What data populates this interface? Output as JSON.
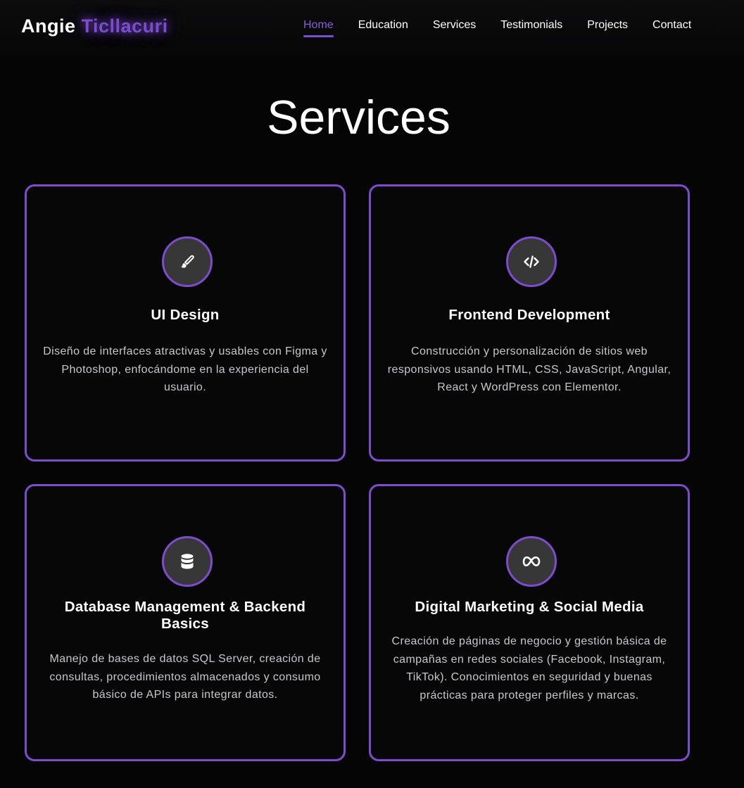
{
  "header": {
    "logo_first": "Angie",
    "logo_last": "Ticllacuri",
    "nav": [
      {
        "label": "Home",
        "active": true
      },
      {
        "label": "Education"
      },
      {
        "label": "Services"
      },
      {
        "label": "Testimonials"
      },
      {
        "label": "Projects"
      },
      {
        "label": "Contact"
      }
    ]
  },
  "main": {
    "title": "Services",
    "cards": [
      {
        "icon": "paintbrush-icon",
        "title": "UI Design",
        "description": "Diseño de interfaces atractivas y usables con Figma y Photoshop, enfocándome en la experiencia del usuario."
      },
      {
        "icon": "code-icon",
        "title": "Frontend Development",
        "description": "Construcción y personalización de sitios web responsivos usando HTML, CSS, JavaScript, Angular, React y WordPress con Elementor."
      },
      {
        "icon": "database-icon",
        "title": "Database Management & Backend Basics",
        "description": "Manejo de bases de datos SQL Server, creación de consultas, procedimientos almacenados y consumo básico de APIs para integrar datos."
      },
      {
        "icon": "meta-icon",
        "title": "Digital Marketing & Social Media",
        "description": "Creación de páginas de negocio y gestión básica de campañas en redes sociales (Facebook, Instagram, TikTok). Conocimientos en seguridad y buenas prácticas para proteger perfiles y marcas."
      }
    ]
  },
  "colors": {
    "accent": "#7c4ccc",
    "background": "#050506",
    "icon_bg": "#373737",
    "text": "#ffffff",
    "muted_text": "#c8c8cc"
  }
}
